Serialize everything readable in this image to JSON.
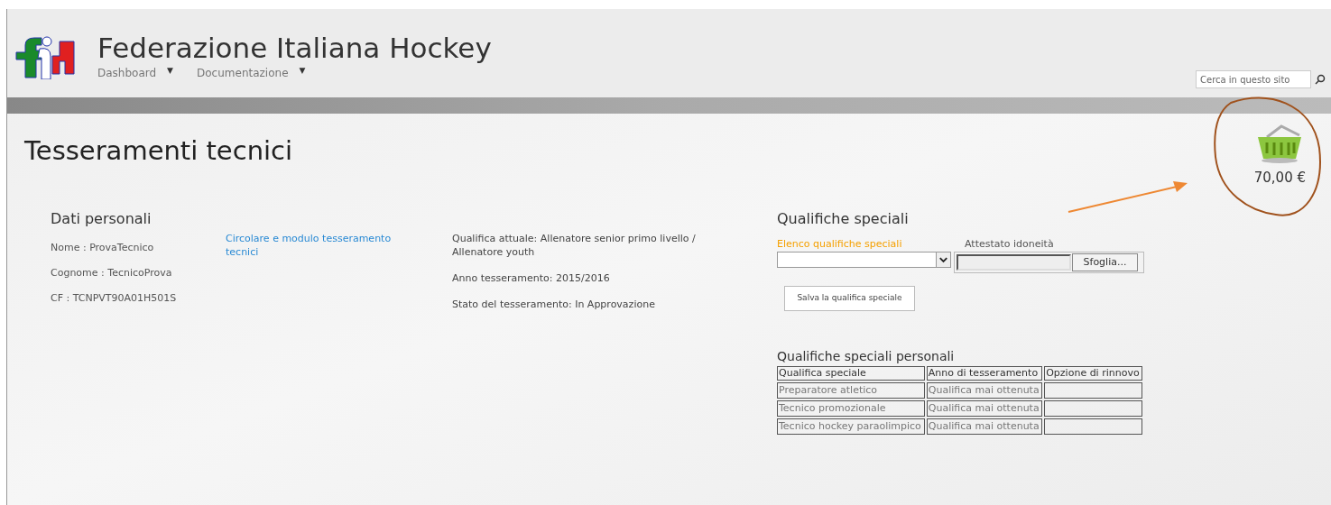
{
  "header": {
    "title": "Federazione Italiana Hockey",
    "nav": [
      {
        "label": "Dashboard",
        "caret": "▼"
      },
      {
        "label": "Documentazione",
        "caret": "▼"
      }
    ],
    "search": {
      "placeholder": "Cerca in questo sito"
    }
  },
  "page_title": "Tesseramenti tecnici",
  "cart": {
    "total": "70,00 €"
  },
  "personal": {
    "title": "Dati personali",
    "fields": [
      "Nome : ProvaTecnico",
      "Cognome : TecnicoProva",
      "CF : TCNPVT90A01H501S"
    ]
  },
  "link": "Circolare e modulo tesseramento tecnici",
  "status": [
    "Qualifica attuale: Allenatore senior primo livello / Allenatore youth",
    "Anno tesseramento: 2015/2016",
    "Stato del tesseramento: In Approvazione"
  ],
  "special": {
    "title": "Qualifiche speciali",
    "select_label": "Elenco qualifiche speciali",
    "file_label": "Attestato idoneità",
    "browse_button": "Sfoglia...",
    "save_button": "Salva la qualifica speciale"
  },
  "table": {
    "title": "Qualifiche speciali personali",
    "columns": [
      "Qualifica speciale",
      "Anno di tesseramento",
      "Opzione di rinnovo"
    ],
    "rows": [
      [
        "Preparatore atletico",
        "Qualifica mai ottenuta",
        ""
      ],
      [
        "Tecnico promozionale",
        "Qualifica mai ottenuta",
        ""
      ],
      [
        "Tecnico hockey paraolimpico",
        "Qualifica mai ottenuta",
        ""
      ]
    ]
  }
}
